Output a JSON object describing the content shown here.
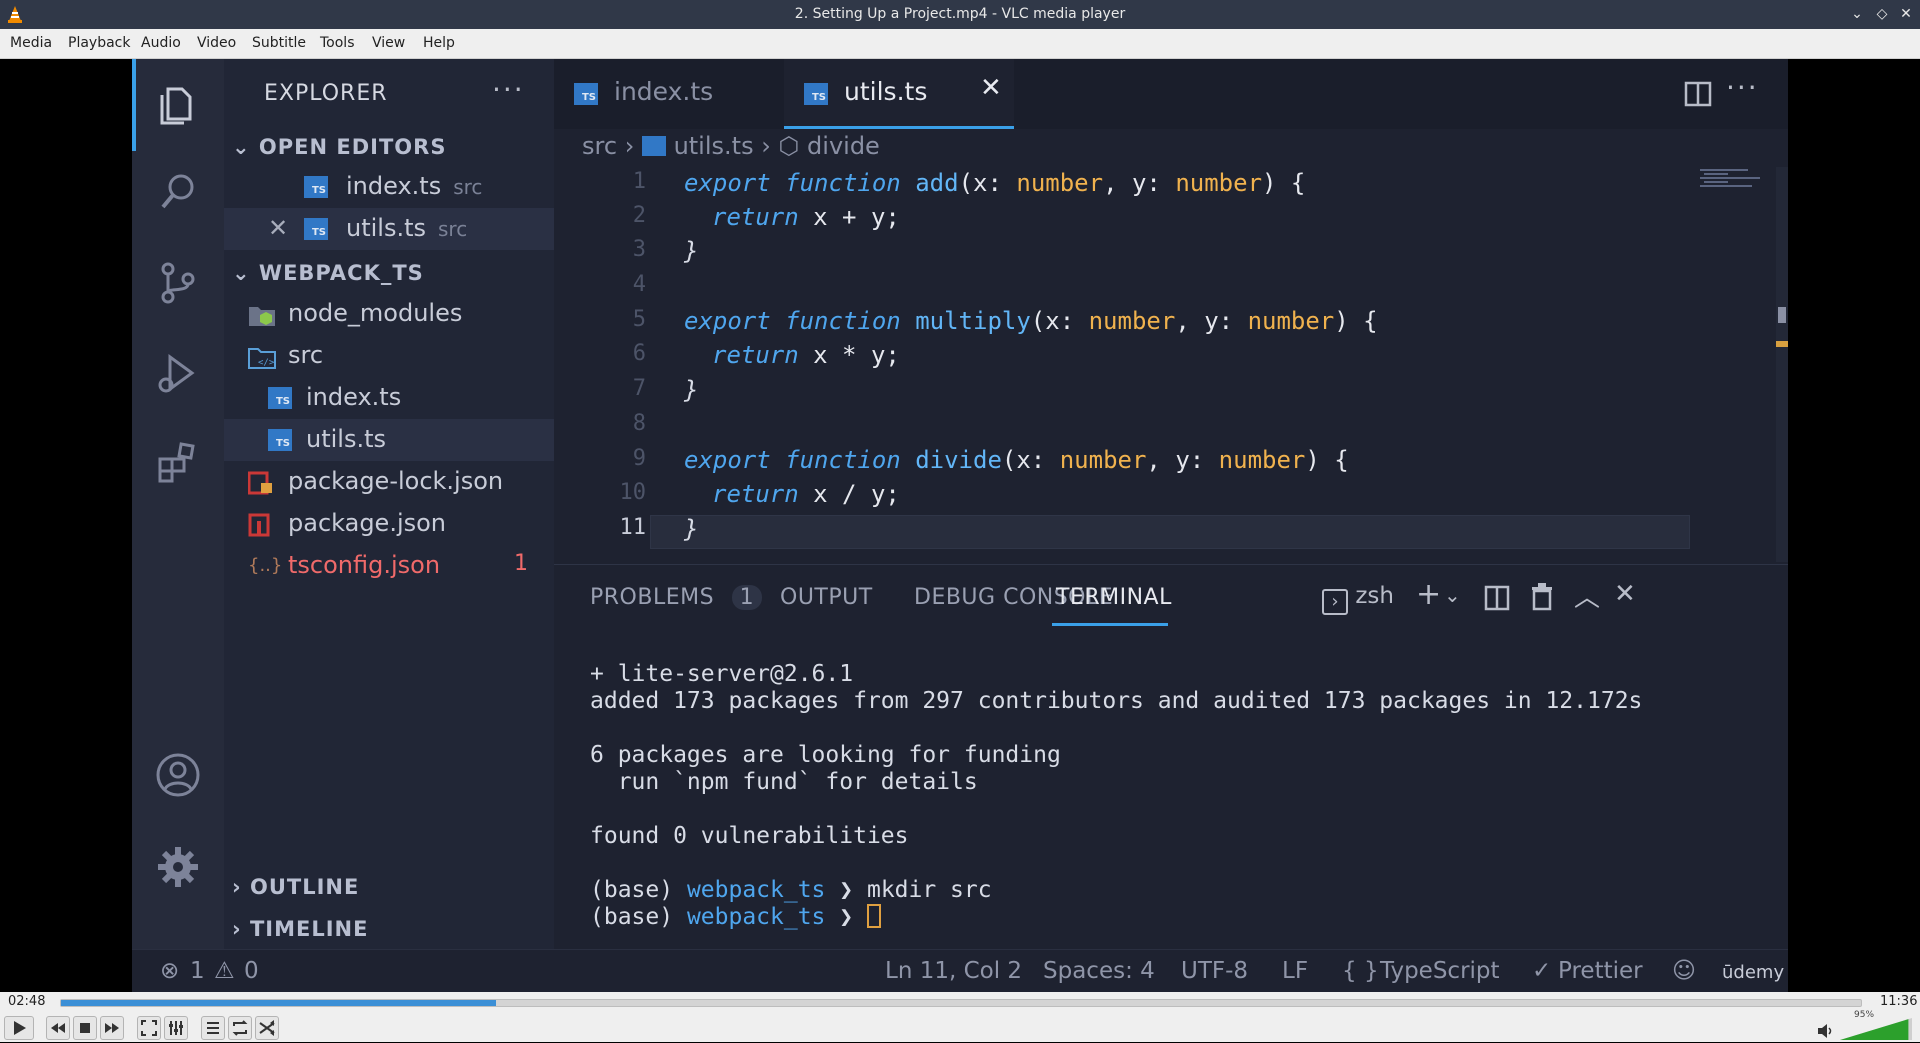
{
  "window": {
    "title": "2. Setting Up a Project.mp4 - VLC media player"
  },
  "menu": [
    "Media",
    "Playback",
    "Audio",
    "Video",
    "Subtitle",
    "Tools",
    "View",
    "Help"
  ],
  "explorer": {
    "title": "EXPLORER",
    "open_editors_label": "OPEN EDITORS",
    "open_editors": [
      {
        "name": "index.ts",
        "dir": "src"
      },
      {
        "name": "utils.ts",
        "dir": "src"
      }
    ],
    "project_label": "WEBPACK_TS",
    "tree": {
      "node_modules": "node_modules",
      "src": "src",
      "index": "index.ts",
      "utils": "utils.ts",
      "package_lock": "package-lock.json",
      "package": "package.json",
      "tsconfig": "tsconfig.json",
      "tsconfig_errors": "1"
    },
    "outline_label": "OUTLINE",
    "timeline_label": "TIMELINE"
  },
  "editor": {
    "tabs": [
      "index.ts",
      "utils.ts"
    ],
    "active_tab": "utils.ts",
    "breadcrumb": {
      "folder": "src",
      "file": "utils.ts",
      "symbol": "divide"
    },
    "line_numbers": [
      "1",
      "2",
      "3",
      "4",
      "5",
      "6",
      "7",
      "8",
      "9",
      "10",
      "11"
    ],
    "code": {
      "l1": {
        "kw": "export function",
        "fn": "add",
        "p1": "(x:",
        "t1": "number",
        "p2": ", y:",
        "t2": "number",
        "p3": ") {"
      },
      "l2": {
        "kw": "return",
        "rest": " x + y;"
      },
      "l3": "}",
      "l5": {
        "kw": "export function",
        "fn": "multiply",
        "p1": "(x:",
        "t1": "number",
        "p2": ", y:",
        "t2": "number",
        "p3": ") {"
      },
      "l6": {
        "kw": "return",
        "rest": " x * y;"
      },
      "l7": "}",
      "l9": {
        "kw": "export function",
        "fn": "divide",
        "p1": "(x:",
        "t1": "number",
        "p2": ", y:",
        "t2": "number",
        "p3": ") {"
      },
      "l10": {
        "kw": "return",
        "rest": " x / y;"
      },
      "l11": "}"
    }
  },
  "panel": {
    "tabs": {
      "problems": "PROBLEMS",
      "problems_count": "1",
      "output": "OUTPUT",
      "debug": "DEBUG CONSOLE",
      "terminal": "TERMINAL"
    },
    "shell": "zsh",
    "terminal": {
      "l1": "+ lite-server@2.6.1",
      "l2": "added 173 packages from 297 contributors and audited 173 packages in 12.172s",
      "l3": "6 packages are looking for funding",
      "l4": "  run `npm fund` for details",
      "l5": "found 0 vulnerabilities",
      "prompt_prefix": "(base) ",
      "prompt_path": "webpack_ts",
      "prompt_arrow": " ❯ ",
      "cmd1": "mkdir src"
    }
  },
  "statusbar": {
    "errors": "1",
    "warnings": "0",
    "position": "Ln 11, Col 2",
    "spaces": "Spaces: 4",
    "encoding": "UTF-8",
    "eol": "LF",
    "language": "TypeScript",
    "formatter": "Prettier",
    "brand": "ūdemy"
  },
  "player": {
    "elapsed": "02:48",
    "total": "11:36",
    "progress_fraction": 0.2414,
    "volume_label": "95%",
    "volume_fraction": 0.95
  },
  "colors": {
    "accent": "#3aa0e8",
    "seek": "#3b8fd6",
    "volume": "#2ca02c"
  }
}
